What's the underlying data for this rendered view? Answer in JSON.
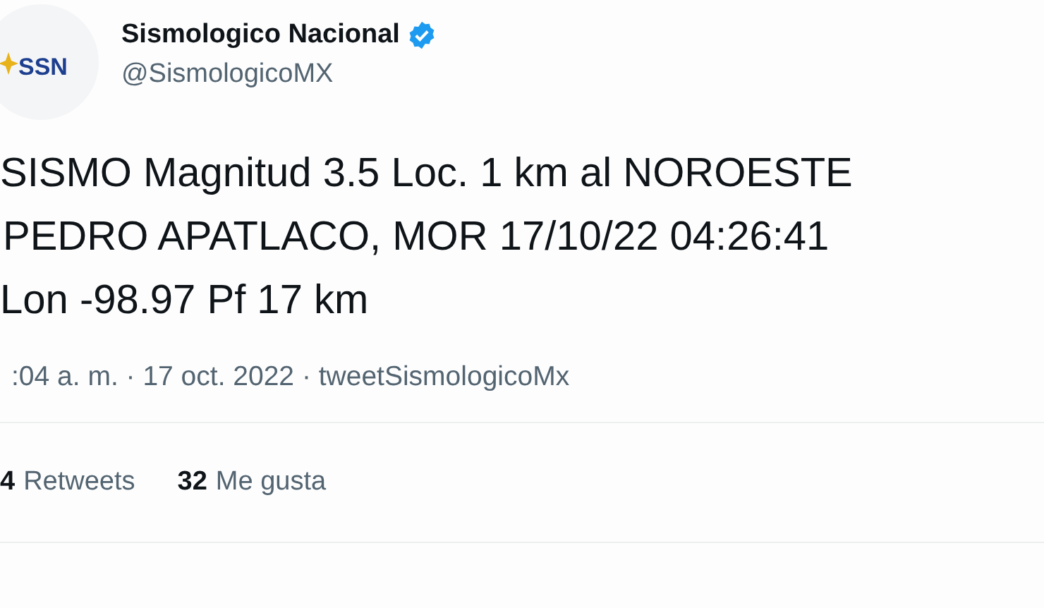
{
  "tweet": {
    "author": {
      "name": "Sismologico Nacional",
      "verified": true,
      "handle": "@SismologicoMX",
      "avatar_text": "SSN"
    },
    "text_lines": [
      "SISMO Magnitud 3.5 Loc. 1 km al NOROESTE",
      "PEDRO APATLACO, MOR 17/10/22 04:26:41",
      "Lon -98.97 Pf 17 km"
    ],
    "meta": ":04 a. m. · 17 oct. 2022 · tweetSismologicoMx",
    "stats": [
      {
        "count": "4",
        "label": "Retweets"
      },
      {
        "count": "32",
        "label": "Me gusta"
      }
    ]
  }
}
